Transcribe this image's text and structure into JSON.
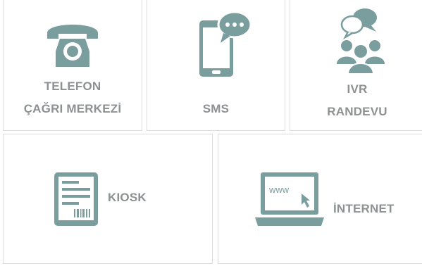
{
  "theme": {
    "accent": "#7a9d9e",
    "label_color": "#8d9192",
    "border_color": "#dcdcdc"
  },
  "tiles": [
    {
      "id": "call-center",
      "icon": "telephone-icon",
      "label_line1": "TELEFON",
      "label_line2": "ÇAĞRI MERKEZİ"
    },
    {
      "id": "sms",
      "icon": "phone-chat-icon",
      "label_line1": "SMS"
    },
    {
      "id": "ivr",
      "icon": "people-chat-icon",
      "label_line1": "IVR",
      "label_line2": "RANDEVU"
    },
    {
      "id": "kiosk",
      "icon": "kiosk-ticket-icon",
      "label_line1": "KIOSK"
    },
    {
      "id": "internet",
      "icon": "laptop-www-icon",
      "label_line1": "İNTERNET",
      "screen_text": "www"
    }
  ]
}
